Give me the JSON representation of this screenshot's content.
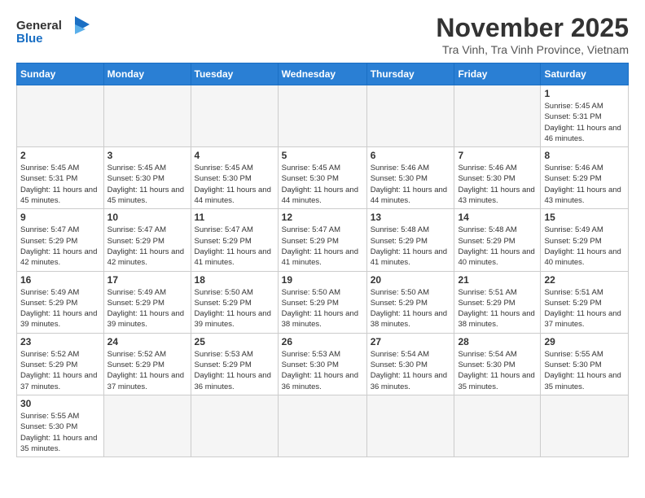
{
  "header": {
    "logo_general": "General",
    "logo_blue": "Blue",
    "month_title": "November 2025",
    "location": "Tra Vinh, Tra Vinh Province, Vietnam"
  },
  "weekdays": [
    "Sunday",
    "Monday",
    "Tuesday",
    "Wednesday",
    "Thursday",
    "Friday",
    "Saturday"
  ],
  "weeks": [
    [
      {
        "day": "",
        "info": ""
      },
      {
        "day": "",
        "info": ""
      },
      {
        "day": "",
        "info": ""
      },
      {
        "day": "",
        "info": ""
      },
      {
        "day": "",
        "info": ""
      },
      {
        "day": "",
        "info": ""
      },
      {
        "day": "1",
        "info": "Sunrise: 5:45 AM\nSunset: 5:31 PM\nDaylight: 11 hours and 46 minutes."
      }
    ],
    [
      {
        "day": "2",
        "info": "Sunrise: 5:45 AM\nSunset: 5:31 PM\nDaylight: 11 hours and 45 minutes."
      },
      {
        "day": "3",
        "info": "Sunrise: 5:45 AM\nSunset: 5:30 PM\nDaylight: 11 hours and 45 minutes."
      },
      {
        "day": "4",
        "info": "Sunrise: 5:45 AM\nSunset: 5:30 PM\nDaylight: 11 hours and 44 minutes."
      },
      {
        "day": "5",
        "info": "Sunrise: 5:45 AM\nSunset: 5:30 PM\nDaylight: 11 hours and 44 minutes."
      },
      {
        "day": "6",
        "info": "Sunrise: 5:46 AM\nSunset: 5:30 PM\nDaylight: 11 hours and 44 minutes."
      },
      {
        "day": "7",
        "info": "Sunrise: 5:46 AM\nSunset: 5:30 PM\nDaylight: 11 hours and 43 minutes."
      },
      {
        "day": "8",
        "info": "Sunrise: 5:46 AM\nSunset: 5:29 PM\nDaylight: 11 hours and 43 minutes."
      }
    ],
    [
      {
        "day": "9",
        "info": "Sunrise: 5:47 AM\nSunset: 5:29 PM\nDaylight: 11 hours and 42 minutes."
      },
      {
        "day": "10",
        "info": "Sunrise: 5:47 AM\nSunset: 5:29 PM\nDaylight: 11 hours and 42 minutes."
      },
      {
        "day": "11",
        "info": "Sunrise: 5:47 AM\nSunset: 5:29 PM\nDaylight: 11 hours and 41 minutes."
      },
      {
        "day": "12",
        "info": "Sunrise: 5:47 AM\nSunset: 5:29 PM\nDaylight: 11 hours and 41 minutes."
      },
      {
        "day": "13",
        "info": "Sunrise: 5:48 AM\nSunset: 5:29 PM\nDaylight: 11 hours and 41 minutes."
      },
      {
        "day": "14",
        "info": "Sunrise: 5:48 AM\nSunset: 5:29 PM\nDaylight: 11 hours and 40 minutes."
      },
      {
        "day": "15",
        "info": "Sunrise: 5:49 AM\nSunset: 5:29 PM\nDaylight: 11 hours and 40 minutes."
      }
    ],
    [
      {
        "day": "16",
        "info": "Sunrise: 5:49 AM\nSunset: 5:29 PM\nDaylight: 11 hours and 39 minutes."
      },
      {
        "day": "17",
        "info": "Sunrise: 5:49 AM\nSunset: 5:29 PM\nDaylight: 11 hours and 39 minutes."
      },
      {
        "day": "18",
        "info": "Sunrise: 5:50 AM\nSunset: 5:29 PM\nDaylight: 11 hours and 39 minutes."
      },
      {
        "day": "19",
        "info": "Sunrise: 5:50 AM\nSunset: 5:29 PM\nDaylight: 11 hours and 38 minutes."
      },
      {
        "day": "20",
        "info": "Sunrise: 5:50 AM\nSunset: 5:29 PM\nDaylight: 11 hours and 38 minutes."
      },
      {
        "day": "21",
        "info": "Sunrise: 5:51 AM\nSunset: 5:29 PM\nDaylight: 11 hours and 38 minutes."
      },
      {
        "day": "22",
        "info": "Sunrise: 5:51 AM\nSunset: 5:29 PM\nDaylight: 11 hours and 37 minutes."
      }
    ],
    [
      {
        "day": "23",
        "info": "Sunrise: 5:52 AM\nSunset: 5:29 PM\nDaylight: 11 hours and 37 minutes."
      },
      {
        "day": "24",
        "info": "Sunrise: 5:52 AM\nSunset: 5:29 PM\nDaylight: 11 hours and 37 minutes."
      },
      {
        "day": "25",
        "info": "Sunrise: 5:53 AM\nSunset: 5:29 PM\nDaylight: 11 hours and 36 minutes."
      },
      {
        "day": "26",
        "info": "Sunrise: 5:53 AM\nSunset: 5:30 PM\nDaylight: 11 hours and 36 minutes."
      },
      {
        "day": "27",
        "info": "Sunrise: 5:54 AM\nSunset: 5:30 PM\nDaylight: 11 hours and 36 minutes."
      },
      {
        "day": "28",
        "info": "Sunrise: 5:54 AM\nSunset: 5:30 PM\nDaylight: 11 hours and 35 minutes."
      },
      {
        "day": "29",
        "info": "Sunrise: 5:55 AM\nSunset: 5:30 PM\nDaylight: 11 hours and 35 minutes."
      }
    ],
    [
      {
        "day": "30",
        "info": "Sunrise: 5:55 AM\nSunset: 5:30 PM\nDaylight: 11 hours and 35 minutes."
      },
      {
        "day": "",
        "info": ""
      },
      {
        "day": "",
        "info": ""
      },
      {
        "day": "",
        "info": ""
      },
      {
        "day": "",
        "info": ""
      },
      {
        "day": "",
        "info": ""
      },
      {
        "day": "",
        "info": ""
      }
    ]
  ]
}
